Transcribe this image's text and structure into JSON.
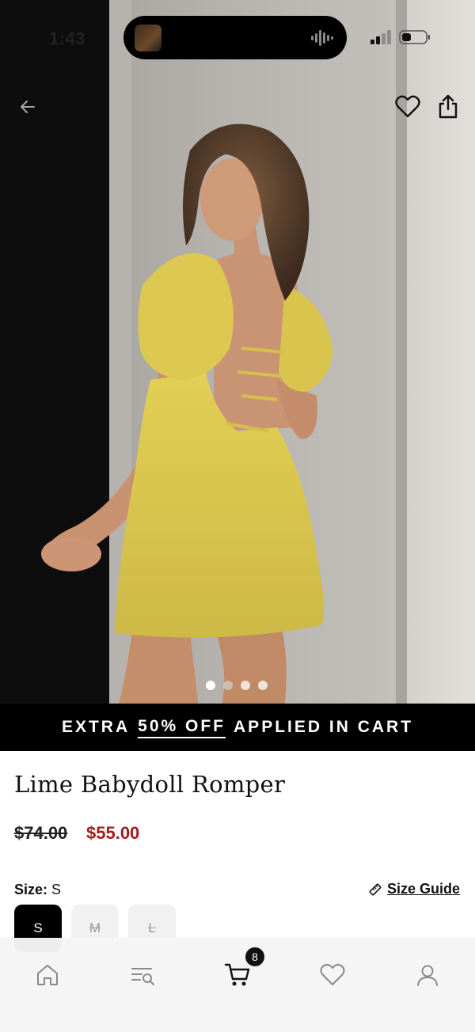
{
  "status": {
    "time": "1:43"
  },
  "gallery": {
    "image_count": 4,
    "active_index": 0
  },
  "promo": {
    "prefix": "EXTRA",
    "highlight": "50% OFF",
    "suffix": "APPLIED IN CART"
  },
  "product": {
    "title": "Lime Babydoll Romper",
    "price_original": "$74.00",
    "price_sale": "$55.00",
    "size_label": "Size:",
    "size_selected": "S",
    "size_guide": "Size Guide",
    "sizes": [
      {
        "label": "S",
        "selected": true,
        "available": true
      },
      {
        "label": "M",
        "selected": false,
        "available": false
      },
      {
        "label": "L",
        "selected": false,
        "available": false
      }
    ]
  },
  "tabbar": {
    "cart_count": "8",
    "tabs": [
      "home-icon",
      "search-list-icon",
      "cart-icon",
      "heart-icon",
      "account-icon"
    ]
  },
  "colors": {
    "sale_red": "#a11d1d",
    "promo_bg": "#000000",
    "garment_yellow": "#d8c449"
  }
}
